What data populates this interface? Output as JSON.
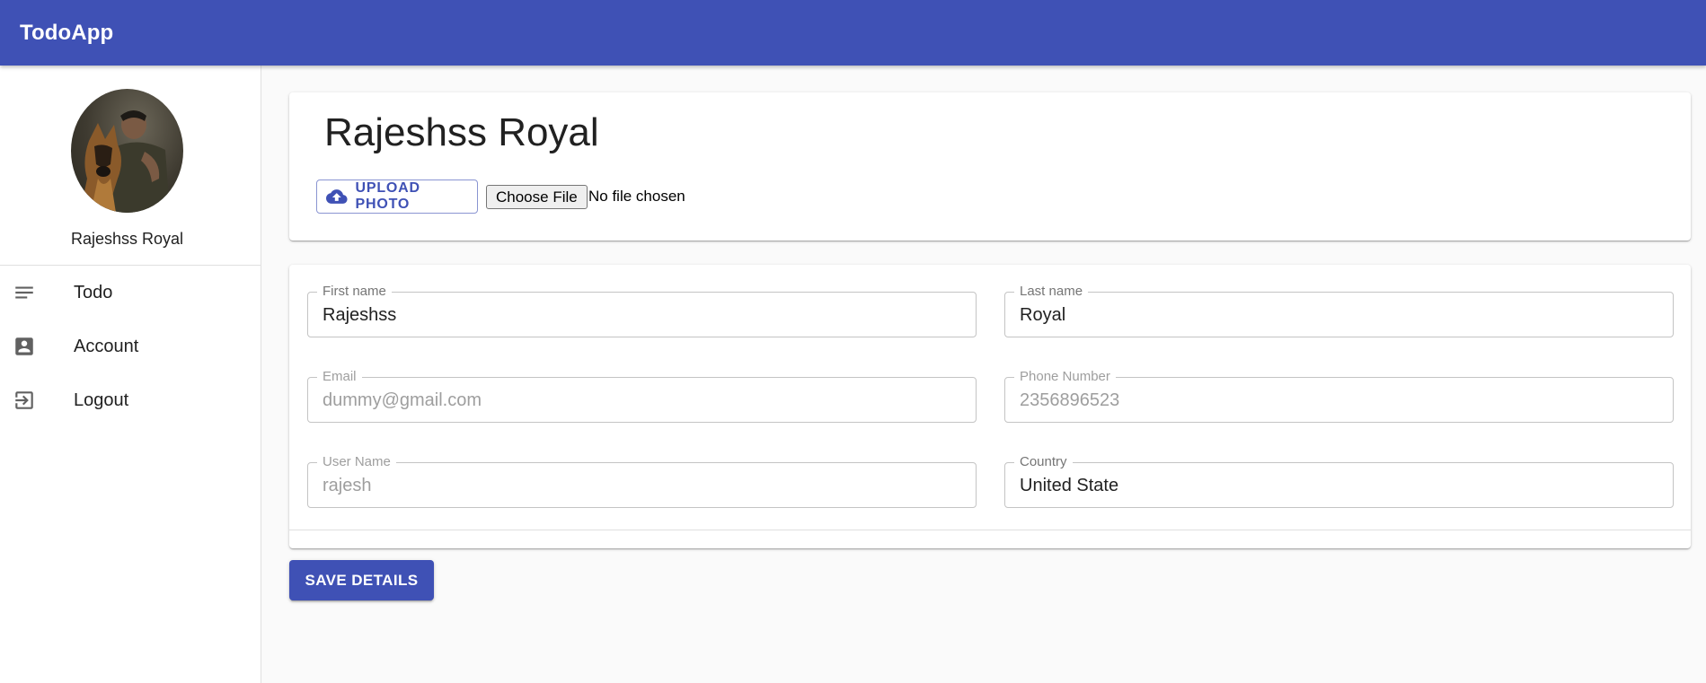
{
  "appbar": {
    "title": "TodoApp"
  },
  "colors": {
    "primary": "#3f51b5",
    "background": "#fafafa"
  },
  "sidebar": {
    "user_name": "Rajeshss Royal",
    "avatar_icon": "profile-photo",
    "items": [
      {
        "label": "Todo",
        "icon": "notes-icon"
      },
      {
        "label": "Account",
        "icon": "account-box-icon"
      },
      {
        "label": "Logout",
        "icon": "exit-icon"
      }
    ]
  },
  "profile_card": {
    "title": "Rajeshss Royal",
    "upload_label": "UPLOAD PHOTO",
    "upload_icon": "cloud-upload-icon",
    "file_button_label": "Choose File",
    "file_status": "No file chosen"
  },
  "form": {
    "first_name": {
      "label": "First name",
      "value": "Rajeshss"
    },
    "last_name": {
      "label": "Last name",
      "value": "Royal"
    },
    "email": {
      "label": "Email",
      "value": "dummy@gmail.com"
    },
    "phone": {
      "label": "Phone Number",
      "value": "2356896523"
    },
    "username": {
      "label": "User Name",
      "value": "rajesh"
    },
    "country": {
      "label": "Country",
      "value": "United State"
    }
  },
  "save_label": "SAVE DETAILS"
}
